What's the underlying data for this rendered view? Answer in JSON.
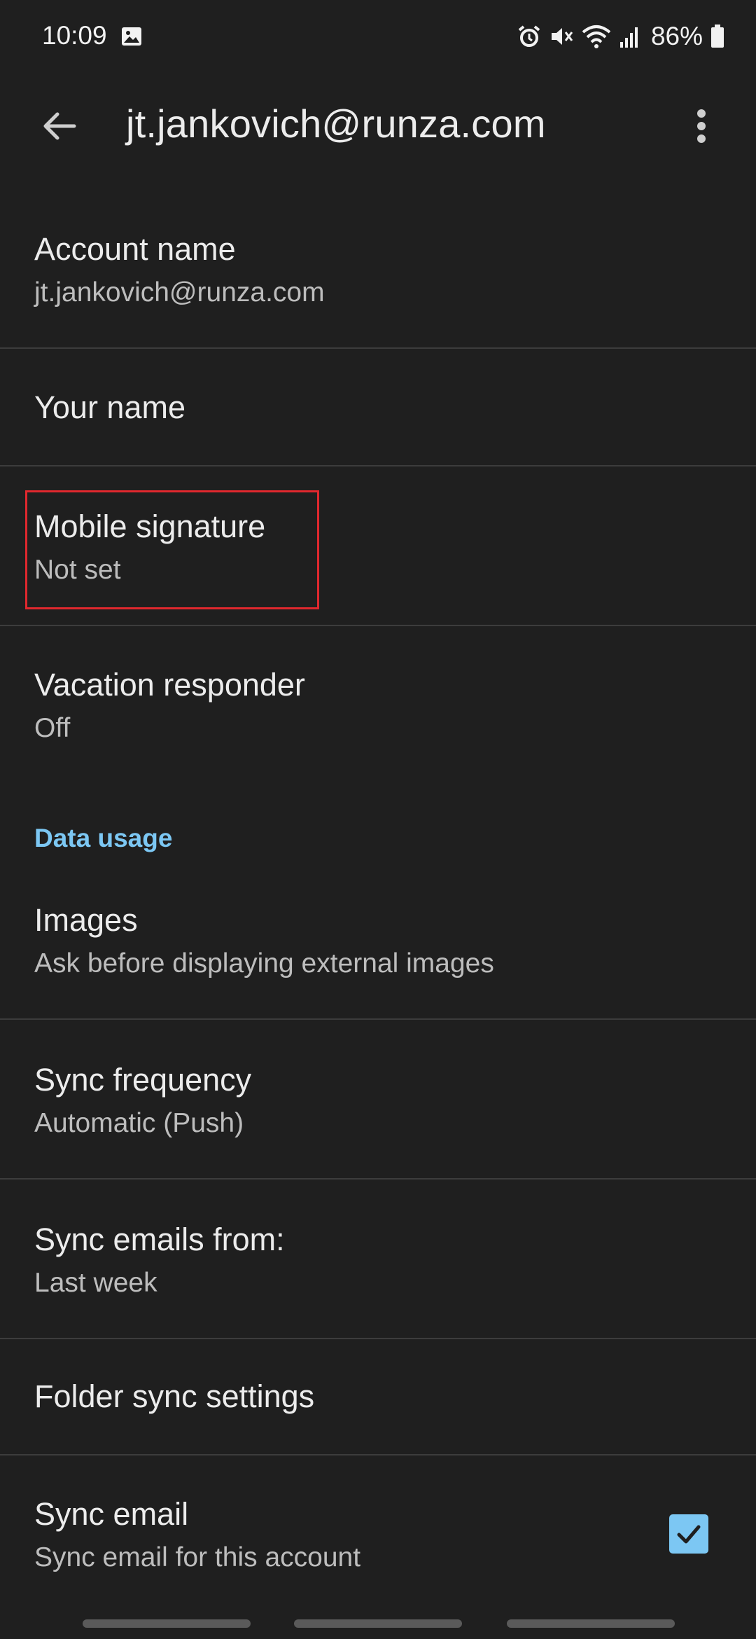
{
  "status_bar": {
    "time": "10:09",
    "battery": "86%"
  },
  "app_bar": {
    "title": "jt.jankovich@runza.com"
  },
  "settings": {
    "account_name": {
      "title": "Account name",
      "summary": "jt.jankovich@runza.com"
    },
    "your_name": {
      "title": "Your name"
    },
    "mobile_signature": {
      "title": "Mobile signature",
      "summary": "Not set"
    },
    "vacation_responder": {
      "title": "Vacation responder",
      "summary": "Off"
    },
    "data_usage_header": "Data usage",
    "images": {
      "title": "Images",
      "summary": "Ask before displaying external images"
    },
    "sync_frequency": {
      "title": "Sync frequency",
      "summary": "Automatic (Push)"
    },
    "sync_emails_from": {
      "title": "Sync emails from:",
      "summary": "Last week"
    },
    "folder_sync": {
      "title": "Folder sync settings"
    },
    "sync_email": {
      "title": "Sync email",
      "summary": "Sync email for this account",
      "checked": true
    }
  },
  "colors": {
    "background": "#1f1f1f",
    "accent": "#7cc7f3",
    "highlight": "#e0282e"
  }
}
